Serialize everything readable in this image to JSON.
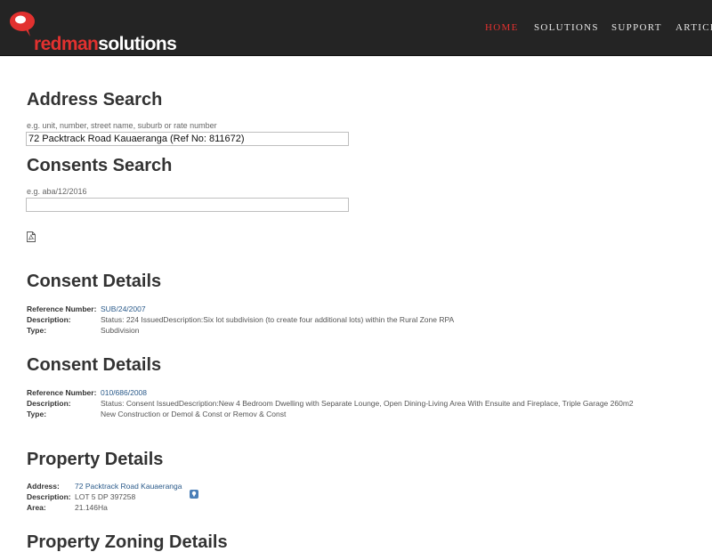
{
  "header": {
    "logo": {
      "part1": "redman",
      "part2": "solutions"
    },
    "nav": [
      {
        "label": "HOME",
        "active": true
      },
      {
        "label": "SOLUTIONS",
        "active": false
      },
      {
        "label": "SUPPORT",
        "active": false
      },
      {
        "label": "ARTICL",
        "active": false
      }
    ]
  },
  "address_search": {
    "title": "Address Search",
    "hint": "e.g. unit, number, street name, suburb or rate number",
    "value": "72 Packtrack Road Kauaeranga (Ref No: 811672)"
  },
  "consents_search": {
    "title": "Consents Search",
    "hint": "e.g. aba/12/2016",
    "value": ""
  },
  "pdf_icon": "pdf-document-icon",
  "consents": [
    {
      "title": "Consent Details",
      "reference_label": "Reference Number:",
      "reference": "SUB/24/2007",
      "description_label": "Description:",
      "description": "Status: 224 IssuedDescription:Six lot subdivision (to create four additional lots) within the Rural Zone RPA",
      "type_label": "Type:",
      "type": "Subdivision"
    },
    {
      "title": "Consent Details",
      "reference_label": "Reference Number:",
      "reference": "010/686/2008",
      "description_label": "Description:",
      "description": "Status: Consent IssuedDescription:New 4 Bedroom Dwelling with Separate Lounge, Open Dining-Living Area With Ensuite and Fireplace, Triple Garage 260m2",
      "type_label": "Type:",
      "type": "New Construction or Demol & Const or Remov & Const"
    }
  ],
  "property": {
    "title": "Property Details",
    "address_label": "Address:",
    "address": "72 Packtrack Road Kauaeranga",
    "description_label": "Description:",
    "description": "LOT 5 DP 397258",
    "area_label": "Area:",
    "area": "21.146Ha"
  },
  "zoning": {
    "title": "Property Zoning Details"
  },
  "colors": {
    "brand_red": "#e2312f",
    "header_bg": "#242424",
    "link": "#2a5a8a"
  }
}
